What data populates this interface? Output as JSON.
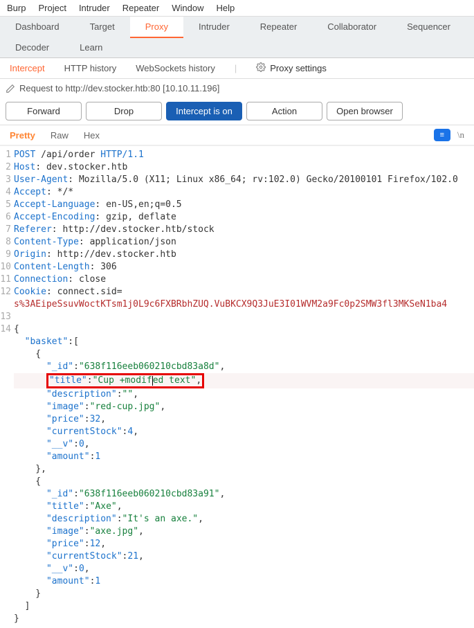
{
  "menubar": [
    "Burp",
    "Project",
    "Intruder",
    "Repeater",
    "Window",
    "Help"
  ],
  "main_tabs": [
    "Dashboard",
    "Target",
    "Proxy",
    "Intruder",
    "Repeater",
    "Collaborator",
    "Sequencer",
    "Decoder",
    "Learn"
  ],
  "main_tab_active": "Proxy",
  "subtabs": {
    "items": [
      "Intercept",
      "HTTP history",
      "WebSockets history"
    ],
    "active": "Intercept",
    "settings_label": "Proxy settings"
  },
  "request_info": "Request to http://dev.stocker.htb:80   [10.10.11.196]",
  "toolbar": {
    "forward": "Forward",
    "drop": "Drop",
    "intercept": "Intercept is on",
    "action": "Action",
    "open_browser": "Open browser"
  },
  "view_tabs": {
    "items": [
      "Pretty",
      "Raw",
      "Hex"
    ],
    "active": "Pretty",
    "newline_icon": "\\n"
  },
  "http": {
    "request_line": {
      "method": "POST",
      "path": "/api/order",
      "version": "HTTP/1.1"
    },
    "headers": {
      "host_k": "Host",
      "host_v": "dev.stocker.htb",
      "ua_k": "User-Agent",
      "ua_v": "Mozilla/5.0 (X11; Linux x86_64; rv:102.0) Gecko/20100101 Firefox/102.0",
      "accept_k": "Accept",
      "accept_v": "*/*",
      "al_k": "Accept-Language",
      "al_v": "en-US,en;q=0.5",
      "ae_k": "Accept-Encoding",
      "ae_v": "gzip, deflate",
      "ref_k": "Referer",
      "ref_v": "http://dev.stocker.htb/stock",
      "ct_k": "Content-Type",
      "ct_v": "application/json",
      "org_k": "Origin",
      "org_v": "http://dev.stocker.htb",
      "cl_k": "Content-Length",
      "cl_v": "306",
      "conn_k": "Connection",
      "conn_v": "close",
      "cookie_k": "Cookie",
      "cookie_name": "connect.sid",
      "cookie_val": "s%3AEipeSsuvWoctKTsm1j0L9c6FXBRbhZUQ.VuBKCX9Q3JuE3I01WVM2a9Fc0p2SMW3fl3MKSeN1ba4"
    },
    "body": {
      "basket_key": "\"basket\"",
      "item1": {
        "id_k": "\"_id\"",
        "id_v": "\"638f116eeb060210cbd83a8d\"",
        "title_k": "\"title\"",
        "title_v_pre": "\"Cup +modif",
        "title_v_post": "ed text\"",
        "desc_k": "\"description\"",
        "desc_v": "\"\"",
        "image_k": "\"image\"",
        "image_v": "\"red-cup.jpg\"",
        "price_k": "\"price\"",
        "price_v": "32",
        "cs_k": "\"currentStock\"",
        "cs_v": "4",
        "v_k": "\"__v\"",
        "v_v": "0",
        "amt_k": "\"amount\"",
        "amt_v": "1"
      },
      "item2": {
        "id_k": "\"_id\"",
        "id_v": "\"638f116eeb060210cbd83a91\"",
        "title_k": "\"title\"",
        "title_v": "\"Axe\"",
        "desc_k": "\"description\"",
        "desc_v": "\"It's an axe.\"",
        "image_k": "\"image\"",
        "image_v": "\"axe.jpg\"",
        "price_k": "\"price\"",
        "price_v": "12",
        "cs_k": "\"currentStock\"",
        "cs_v": "21",
        "v_k": "\"__v\"",
        "v_v": "0",
        "amt_k": "\"amount\"",
        "amt_v": "1"
      }
    }
  }
}
